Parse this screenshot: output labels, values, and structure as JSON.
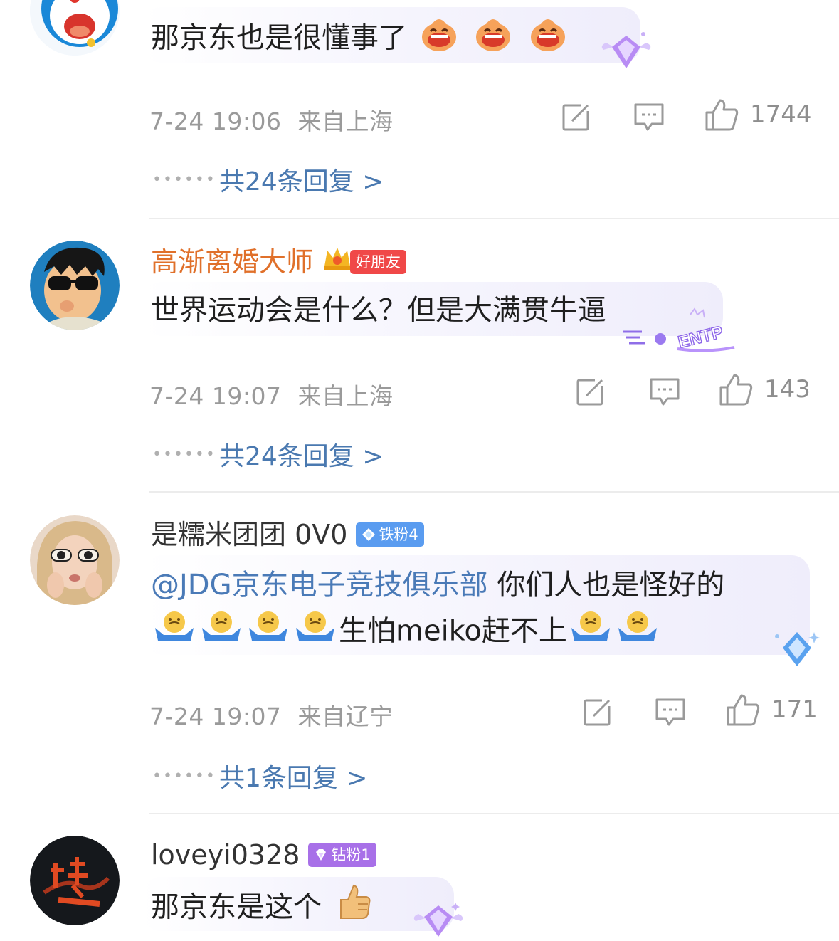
{
  "comments": [
    {
      "text": "那京东也是很懂事了",
      "emoji": "laughing-emoji",
      "time": "7-24 19:06",
      "location": "来自上海",
      "likes": "1744",
      "replies": "共24条回复 >"
    },
    {
      "username": "高渐离婚大师",
      "badge": "好朋友",
      "text": "世界运动会是什么？但是大满贯牛逼",
      "decoration": "ENTP",
      "time": "7-24 19:07",
      "location": "来自上海",
      "likes": "143",
      "replies": "共24条回复 >"
    },
    {
      "username": "是糯米团团 0V0",
      "badge": "铁粉4",
      "mention": "@JDG京东电子竞技俱乐部",
      "text_line1": " 你们人也是怪好的",
      "text_line2": "生怕meiko赶不上",
      "emoji": "shrug-emoji",
      "time": "7-24 19:07",
      "location": "来自辽宁",
      "likes": "171",
      "replies": "共1条回复 >"
    },
    {
      "username": "loveyi0328",
      "badge": "钻粉1",
      "text": "那京东是这个",
      "emoji": "thumbs-up-emoji"
    }
  ],
  "icons": [
    "repost-icon",
    "comment-icon",
    "like-icon"
  ],
  "colors": {
    "vip_name": "#e0702a",
    "link": "#4a79b0",
    "meta": "#9a9a9a",
    "badge_friend": "#f04848",
    "badge_iron": "#5a9cf0",
    "badge_diamond": "#a870e8"
  }
}
